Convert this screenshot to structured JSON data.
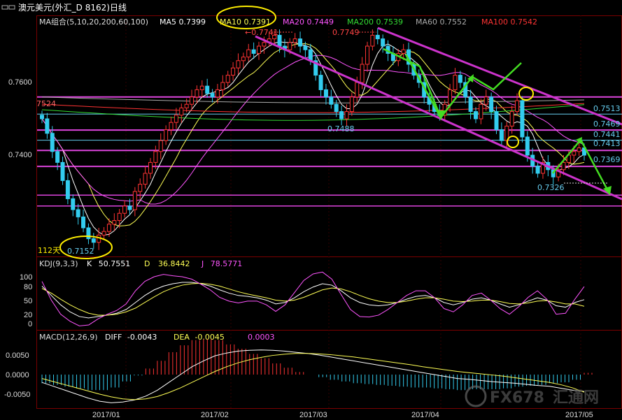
{
  "window": {
    "title": "澳元美元(外汇_D 8162)日线",
    "icon": "chart-window-icon"
  },
  "ma_header": {
    "group_label": "MA组合(5,10,20,200,60,100)",
    "items": [
      {
        "name": "MA5",
        "value": "0.7399",
        "color": "#ffffff"
      },
      {
        "name": "MA10",
        "value": "0.7391",
        "color": "#ffff55"
      },
      {
        "name": "MA20",
        "value": "0.7449",
        "color": "#ff55ff"
      },
      {
        "name": "MA200",
        "value": "0.7539",
        "color": "#33dd33"
      },
      {
        "name": "MA60",
        "value": "0.7552",
        "color": "#aaaaaa"
      },
      {
        "name": "MA100",
        "value": "0.7542",
        "color": "#ff3333"
      }
    ]
  },
  "kdj_header": {
    "label": "KDJ(9,3,3)",
    "k_label": "K",
    "k_value": "50.7551",
    "d_label": "D",
    "d_value": "36.8442",
    "j_label": "J",
    "j_value": "78.5771"
  },
  "macd_header": {
    "label": "MACD(12,26,9)",
    "diff_label": "DIFF",
    "diff_value": "-0.0043",
    "dea_label": "DEA",
    "dea_value": "-0.0045",
    "macd_value": "0.0003"
  },
  "price_axis": {
    "ticks": [
      "0.7600",
      "0.7400"
    ]
  },
  "kdj_axis": {
    "ticks": [
      "100",
      "80",
      "50",
      "20",
      "0"
    ]
  },
  "macd_axis": {
    "ticks": [
      "0.0050",
      "0.0000",
      "-0.0050"
    ]
  },
  "x_axis": {
    "ticks": [
      "2017/01",
      "2017/02",
      "2017/03",
      "2017/04",
      "2017/05"
    ]
  },
  "annotations": {
    "low_value": "0.7152",
    "low_days": "112天",
    "high1": "0.7741",
    "high2": "0.7749",
    "mid_low": "0.7488",
    "recent_low": "0.7326",
    "left_level": "7524",
    "right_levels": [
      "0.7513",
      "0.7469",
      "0.7441",
      "0.7413",
      "0.7369"
    ]
  },
  "watermark": {
    "text": "FX678",
    "sub": "汇通网"
  },
  "colors": {
    "up": "#ff3333",
    "down": "#33ccee",
    "channel": "#cc33cc",
    "level": "#dd44dd",
    "arrow": "#44dd22",
    "highlight": "#ffee00"
  },
  "chart_data": {
    "type": "candlestick",
    "title": "澳元美元(外汇_D 8162)日线",
    "ylim": [
      0.712,
      0.778
    ],
    "x": [
      "2017/01",
      "2017/02",
      "2017/03",
      "2017/04",
      "2017/05"
    ],
    "key_points": [
      {
        "label": "low",
        "value": 0.7152
      },
      {
        "label": "high",
        "value": 0.7741
      },
      {
        "label": "high",
        "value": 0.7749
      },
      {
        "label": "low",
        "value": 0.7488
      },
      {
        "label": "low",
        "value": 0.7326
      }
    ],
    "horizontal_levels": [
      0.7524,
      0.7513,
      0.7469,
      0.7441,
      0.7413,
      0.7369
    ],
    "closes": [
      0.75,
      0.746,
      0.741,
      0.738,
      0.733,
      0.728,
      0.725,
      0.723,
      0.72,
      0.717,
      0.716,
      0.718,
      0.719,
      0.721,
      0.722,
      0.724,
      0.726,
      0.725,
      0.73,
      0.732,
      0.735,
      0.738,
      0.741,
      0.744,
      0.747,
      0.749,
      0.751,
      0.753,
      0.754,
      0.756,
      0.758,
      0.759,
      0.757,
      0.756,
      0.758,
      0.76,
      0.762,
      0.764,
      0.766,
      0.767,
      0.769,
      0.768,
      0.77,
      0.771,
      0.772,
      0.773,
      0.77,
      0.769,
      0.771,
      0.772,
      0.77,
      0.769,
      0.766,
      0.762,
      0.758,
      0.756,
      0.754,
      0.752,
      0.75,
      0.752,
      0.756,
      0.76,
      0.765,
      0.77,
      0.773,
      0.772,
      0.77,
      0.768,
      0.766,
      0.768,
      0.769,
      0.765,
      0.762,
      0.76,
      0.756,
      0.754,
      0.752,
      0.751,
      0.754,
      0.758,
      0.762,
      0.76,
      0.756,
      0.752,
      0.75,
      0.754,
      0.756,
      0.752,
      0.747,
      0.744,
      0.748,
      0.752,
      0.755,
      0.745,
      0.74,
      0.737,
      0.735,
      0.738,
      0.736,
      0.734,
      0.736,
      0.738,
      0.74,
      0.741,
      0.742,
      0.74
    ],
    "kdj": {
      "K": [
        80,
        60,
        40,
        25,
        15,
        12,
        15,
        18,
        22,
        30,
        45,
        60,
        72,
        80,
        85,
        88,
        88,
        85,
        80,
        72,
        65,
        60,
        58,
        55,
        50,
        42,
        45,
        55,
        68,
        78,
        85,
        82,
        70,
        55,
        45,
        40,
        38,
        40,
        45,
        52,
        58,
        60,
        55,
        45,
        40,
        45,
        52,
        55,
        50,
        42,
        35,
        40,
        48,
        55,
        50,
        38,
        35,
        45,
        51
      ],
      "D": [
        75,
        65,
        52,
        40,
        30,
        22,
        18,
        18,
        20,
        25,
        33,
        45,
        57,
        68,
        76,
        82,
        85,
        86,
        84,
        80,
        74,
        68,
        63,
        59,
        55,
        50,
        48,
        50,
        56,
        64,
        72,
        76,
        74,
        68,
        60,
        53,
        48,
        45,
        45,
        48,
        52,
        55,
        55,
        52,
        48,
        47,
        48,
        50,
        50,
        47,
        43,
        42,
        44,
        48,
        49,
        46,
        42,
        42,
        37
      ],
      "J": [
        90,
        50,
        20,
        5,
        -5,
        -3,
        10,
        20,
        28,
        42,
        70,
        90,
        100,
        105,
        102,
        100,
        95,
        84,
        72,
        56,
        48,
        44,
        48,
        48,
        40,
        26,
        40,
        66,
        92,
        106,
        110,
        95,
        62,
        30,
        15,
        14,
        18,
        30,
        45,
        60,
        70,
        70,
        55,
        32,
        25,
        40,
        60,
        65,
        50,
        32,
        20,
        36,
        56,
        70,
        52,
        20,
        22,
        52,
        79
      ]
    },
    "macd": {
      "DIFF": [
        -0.002,
        -0.003,
        -0.004,
        -0.005,
        -0.006,
        -0.0068,
        -0.0072,
        -0.007,
        -0.0065,
        -0.0055,
        -0.004,
        -0.002,
        0,
        0.002,
        0.0035,
        0.0048,
        0.0055,
        0.006,
        0.0062,
        0.0063,
        0.0062,
        0.006,
        0.0057,
        0.0054,
        0.005,
        0.0045,
        0.004,
        0.0035,
        0.003,
        0.0025,
        0.002,
        0.0015,
        0.001,
        0.0005,
        0,
        -0.0005,
        -0.001,
        -0.0012,
        -0.0015,
        -0.0018,
        -0.002,
        -0.0022,
        -0.0025,
        -0.0028,
        -0.003,
        -0.0035,
        -0.004,
        -0.0043
      ],
      "DEA": [
        -0.001,
        -0.0018,
        -0.0026,
        -0.0034,
        -0.0042,
        -0.005,
        -0.0057,
        -0.0062,
        -0.0064,
        -0.0062,
        -0.0056,
        -0.0046,
        -0.0034,
        -0.002,
        -0.0006,
        0.0008,
        0.002,
        0.003,
        0.0038,
        0.0044,
        0.0049,
        0.0052,
        0.0054,
        0.0054,
        0.0053,
        0.0051,
        0.0048,
        0.0045,
        0.0041,
        0.0037,
        0.0033,
        0.0029,
        0.0025,
        0.002,
        0.0016,
        0.0012,
        0.0008,
        0.0005,
        0.0002,
        -0.0001,
        -0.0004,
        -0.0008,
        -0.0012,
        -0.0016,
        -0.002,
        -0.0026,
        -0.0034,
        -0.0045
      ]
    }
  }
}
